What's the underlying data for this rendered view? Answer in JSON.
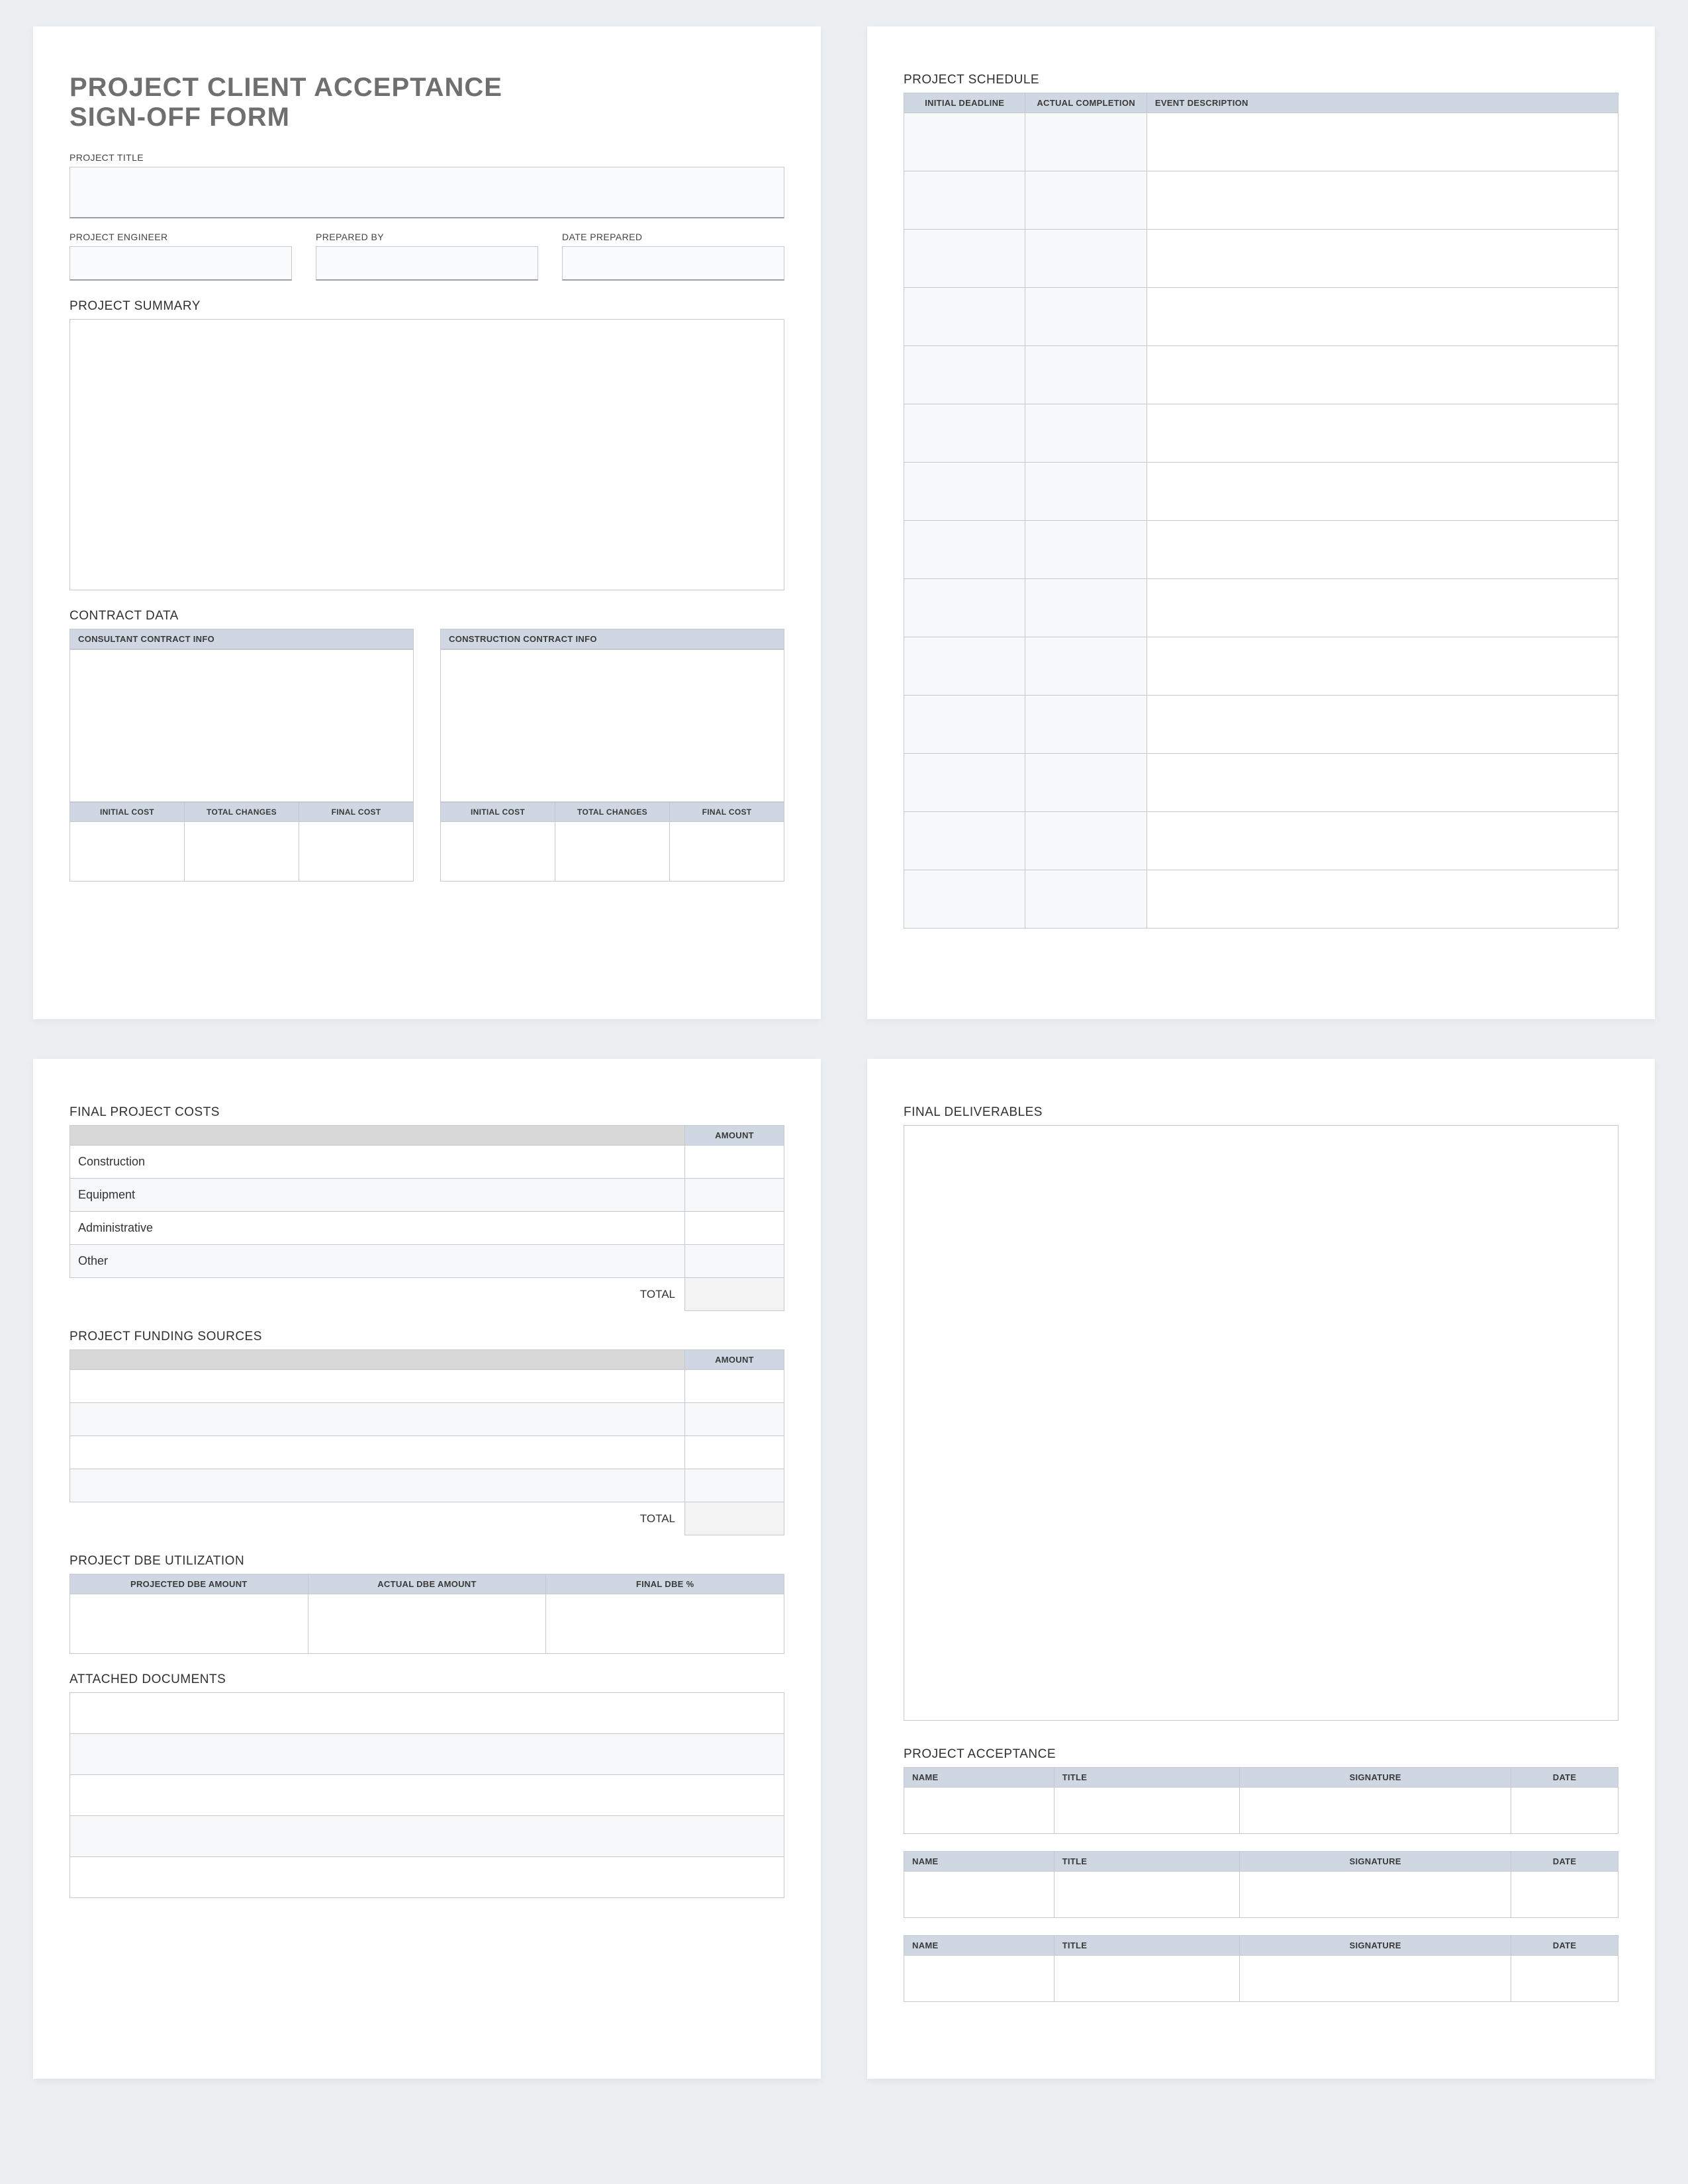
{
  "title_line1": "PROJECT CLIENT ACCEPTANCE",
  "title_line2": "SIGN-OFF FORM",
  "labels": {
    "project_title": "PROJECT TITLE",
    "project_engineer": "PROJECT ENGINEER",
    "prepared_by": "PREPARED BY",
    "date_prepared": "DATE PREPARED",
    "project_summary": "PROJECT SUMMARY",
    "contract_data": "CONTRACT DATA",
    "consultant_header": "CONSULTANT CONTRACT INFO",
    "construction_header": "CONSTRUCTION CONTRACT INFO",
    "initial_cost": "INITIAL COST",
    "total_changes": "TOTAL CHANGES",
    "final_cost": "FINAL COST",
    "project_schedule": "PROJECT SCHEDULE",
    "initial_deadline": "INITIAL DEADLINE",
    "actual_completion": "ACTUAL COMPLETION",
    "event_description": "EVENT DESCRIPTION",
    "final_project_costs": "FINAL PROJECT COSTS",
    "amount": "AMOUNT",
    "total": "TOTAL",
    "project_funding_sources": "PROJECT FUNDING SOURCES",
    "project_dbe": "PROJECT DBE UTILIZATION",
    "projected_dbe": "PROJECTED DBE AMOUNT",
    "actual_dbe": "ACTUAL DBE AMOUNT",
    "final_dbe_pct": "FINAL DBE %",
    "attached_documents": "ATTACHED DOCUMENTS",
    "final_deliverables": "FINAL DELIVERABLES",
    "project_acceptance": "PROJECT ACCEPTANCE",
    "name": "NAME",
    "title_col": "TITLE",
    "signature": "SIGNATURE",
    "date": "DATE"
  },
  "final_costs_rows": [
    "Construction",
    "Equipment",
    "Administrative",
    "Other"
  ],
  "funding_rows": 4,
  "schedule_rows": 14,
  "attached_rows": 5,
  "acceptance_blocks": 3
}
